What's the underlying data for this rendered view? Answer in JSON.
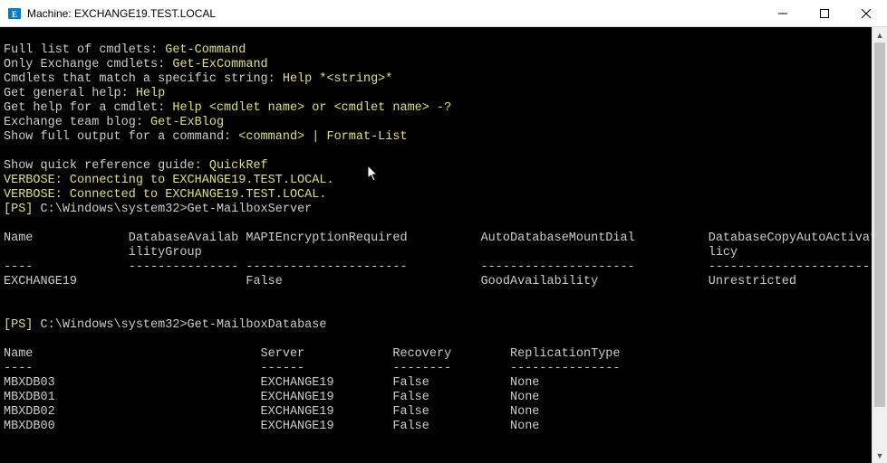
{
  "window": {
    "title": "Machine: EXCHANGE19.TEST.LOCAL"
  },
  "terminal": {
    "help": {
      "fullList": {
        "label": "Full list of cmdlets: ",
        "cmd": "Get-Command"
      },
      "onlyExchange": {
        "label": "Only Exchange cmdlets: ",
        "cmd": "Get-ExCommand"
      },
      "matchString": {
        "label": "Cmdlets that match a specific string: ",
        "cmd": "Help *<string>*"
      },
      "generalHelp": {
        "label": "Get general help: ",
        "cmd": "Help"
      },
      "cmdletHelp": {
        "label": "Get help for a cmdlet: ",
        "cmd": "Help <cmdlet name> or <cmdlet name> -?"
      },
      "teamBlog": {
        "label": "Exchange team blog: ",
        "cmd": "Get-ExBlog"
      },
      "fullOutput": {
        "label": "Show full output for a command: ",
        "cmd": "<command> | Format-List"
      },
      "quickRef": {
        "label": "Show quick reference guide: ",
        "cmd": "QuickRef"
      }
    },
    "verbose": {
      "connecting": "VERBOSE: Connecting to EXCHANGE19.TEST.LOCAL.",
      "connected": "VERBOSE: Connected to EXCHANGE19.TEST.LOCAL."
    },
    "prompt1": {
      "ps": "[PS] ",
      "path": "C:\\Windows\\system32>",
      "cmd": "Get-MailboxServer"
    },
    "table1": {
      "headers": {
        "name": "Name",
        "dag1": "DatabaseAvailab",
        "dag2": "ilityGroup",
        "mapi": "MAPIEncryptionRequired",
        "auto": "AutoDatabaseMountDial",
        "pol1": "DatabaseCopyAutoActivationPo",
        "pol2": "licy"
      },
      "dash": {
        "name": "----",
        "dag": "---------------",
        "mapi": "----------------------",
        "auto": "---------------------",
        "pol": "----------------------------"
      },
      "row": {
        "name": "EXCHANGE19",
        "dag": "",
        "mapi": "False",
        "auto": "GoodAvailability",
        "pol": "Unrestricted"
      }
    },
    "prompt2": {
      "ps": "[PS] ",
      "path": "C:\\Windows\\system32>",
      "cmd": "Get-MailboxDatabase"
    },
    "table2": {
      "headers": {
        "name": "Name",
        "server": "Server",
        "recovery": "Recovery",
        "repl": "ReplicationType"
      },
      "dash": {
        "name": "----",
        "server": "------",
        "recovery": "--------",
        "repl": "---------------"
      },
      "rows": [
        {
          "name": "MBXDB03",
          "server": "EXCHANGE19",
          "recovery": "False",
          "repl": "None"
        },
        {
          "name": "MBXDB01",
          "server": "EXCHANGE19",
          "recovery": "False",
          "repl": "None"
        },
        {
          "name": "MBXDB02",
          "server": "EXCHANGE19",
          "recovery": "False",
          "repl": "None"
        },
        {
          "name": "MBXDB00",
          "server": "EXCHANGE19",
          "recovery": "False",
          "repl": "None"
        }
      ]
    }
  }
}
